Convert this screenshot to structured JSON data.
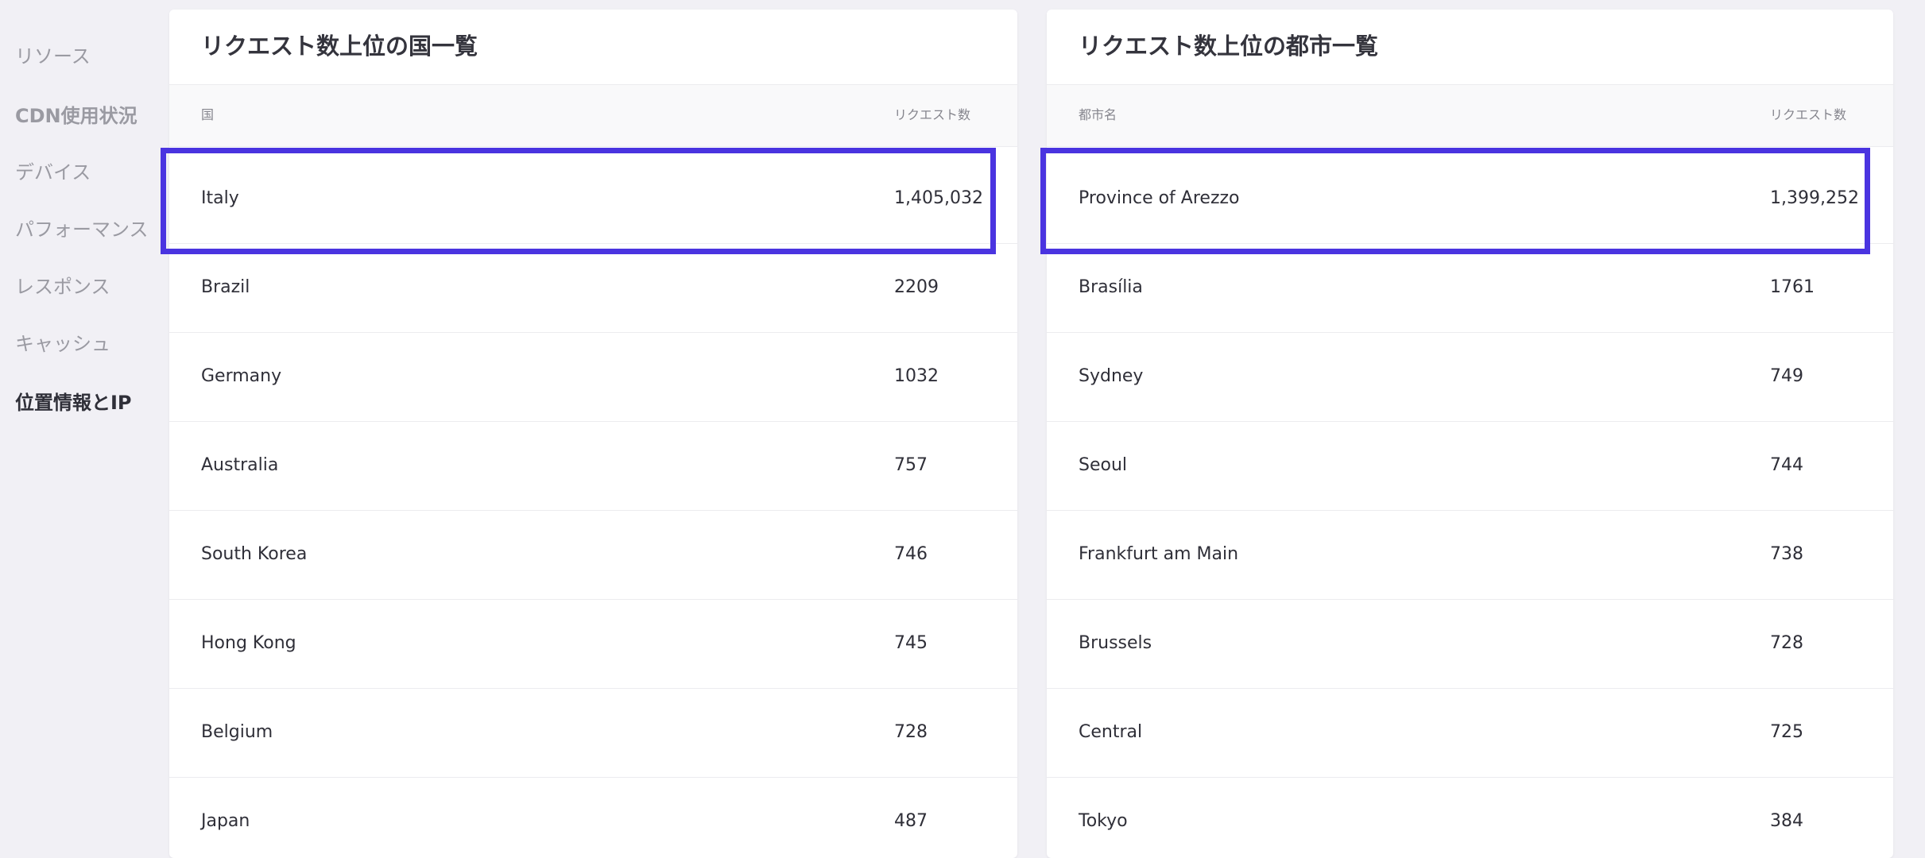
{
  "sidebar": {
    "items": [
      {
        "label": "リソース"
      },
      {
        "label": "CDN使用状況"
      },
      {
        "label": "デバイス"
      },
      {
        "label": "パフォーマンス"
      },
      {
        "label": "レスポンス"
      },
      {
        "label": "キャッシュ"
      },
      {
        "label": "位置情報とIP"
      }
    ],
    "active_label": "位置情報とIP"
  },
  "countries_card": {
    "title": "リクエスト数上位の国一覧",
    "columns": {
      "name": "国",
      "value": "リクエスト数"
    },
    "rows": [
      {
        "name": "Italy",
        "value": "1,405,032"
      },
      {
        "name": "Brazil",
        "value": "2209"
      },
      {
        "name": "Germany",
        "value": "1032"
      },
      {
        "name": "Australia",
        "value": "757"
      },
      {
        "name": "South Korea",
        "value": "746"
      },
      {
        "name": "Hong Kong",
        "value": "745"
      },
      {
        "name": "Belgium",
        "value": "728"
      },
      {
        "name": "Japan",
        "value": "487"
      }
    ]
  },
  "cities_card": {
    "title": "リクエスト数上位の都市一覧",
    "columns": {
      "name": "都市名",
      "value": "リクエスト数"
    },
    "rows": [
      {
        "name": "Province of Arezzo",
        "value": "1,399,252"
      },
      {
        "name": "Brasília",
        "value": "1761"
      },
      {
        "name": "Sydney",
        "value": "749"
      },
      {
        "name": "Seoul",
        "value": "744"
      },
      {
        "name": "Frankfurt am Main",
        "value": "738"
      },
      {
        "name": "Brussels",
        "value": "728"
      },
      {
        "name": "Central",
        "value": "725"
      },
      {
        "name": "Tokyo",
        "value": "384"
      }
    ]
  },
  "colors": {
    "background": "#f1f0f5",
    "card": "#ffffff",
    "highlight": "#4a34e0",
    "sidebar_text": "#9a9aa2",
    "sidebar_active": "#2f2f38"
  }
}
